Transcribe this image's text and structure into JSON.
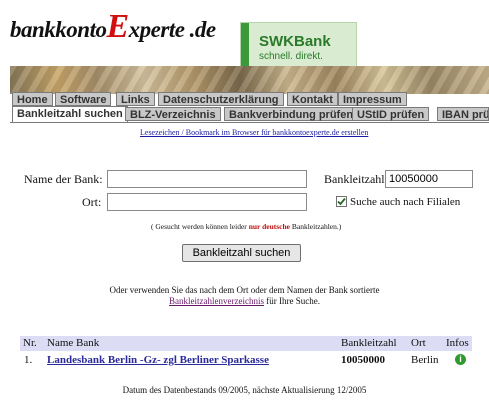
{
  "header": {
    "logo_part1": "bankkonto",
    "logo_e": "E",
    "logo_part2": "xperte .de",
    "banner_title": "SWKBank",
    "banner_subtitle": "schnell. direkt."
  },
  "nav": {
    "top_tabs": [
      "Home",
      "Software",
      "Links",
      "Datenschutzerklärung",
      "Kontakt",
      "Impressum"
    ],
    "sub_tabs": [
      "Bankleitzahl suchen",
      "BLZ-Verzeichnis",
      "Bankverbindung prüfen",
      "UStID prüfen",
      "IBAN prü"
    ],
    "active_sub_tab": "Bankleitzahl suchen"
  },
  "bookmark_link": "Lesezeichen / Bookmark im Browser für bankkontoexperte.de erstellen",
  "form": {
    "bank_name_label": "Name der Bank:",
    "bank_name_value": "",
    "ort_label": "Ort:",
    "ort_value": "",
    "blz_label": "Bankleitzahl:",
    "blz_value": "10050000",
    "filialen_label": "Suche auch nach Filialen",
    "filialen_checked": true,
    "note_prefix": "( Gesucht werden können leider",
    "note_highlight": "nur deutsche",
    "note_suffix": "Bankleitzahlen.)",
    "submit_label": "Bankleitzahl suchen"
  },
  "hint": {
    "line1": "Oder verwenden Sie das nach dem Ort oder dem Namen der Bank sortierte",
    "link": "Bankleitzahlenverzeichnis",
    "line2_suffix": "für Ihre Suche."
  },
  "results": {
    "headers": [
      "Nr.",
      "Name Bank",
      "Bankleitzahl",
      "Ort",
      "Infos"
    ],
    "rows": [
      {
        "nr": "1.",
        "name": "Landesbank Berlin -Gz- zgl Berliner Sparkasse",
        "blz": "10050000",
        "ort": "Berlin",
        "info_icon": "info-icon"
      }
    ]
  },
  "footer": "Datum des Datenbestands 09/2005, nächste Aktualisierung 12/2005",
  "colors": {
    "logo_accent": "#d01010",
    "tab_bg": "#c8c8c8",
    "table_header_bg": "#dcdcf4",
    "link": "#1a1aa0",
    "result_link": "#2a2a9a",
    "banner_green": "#2a7a2a"
  }
}
